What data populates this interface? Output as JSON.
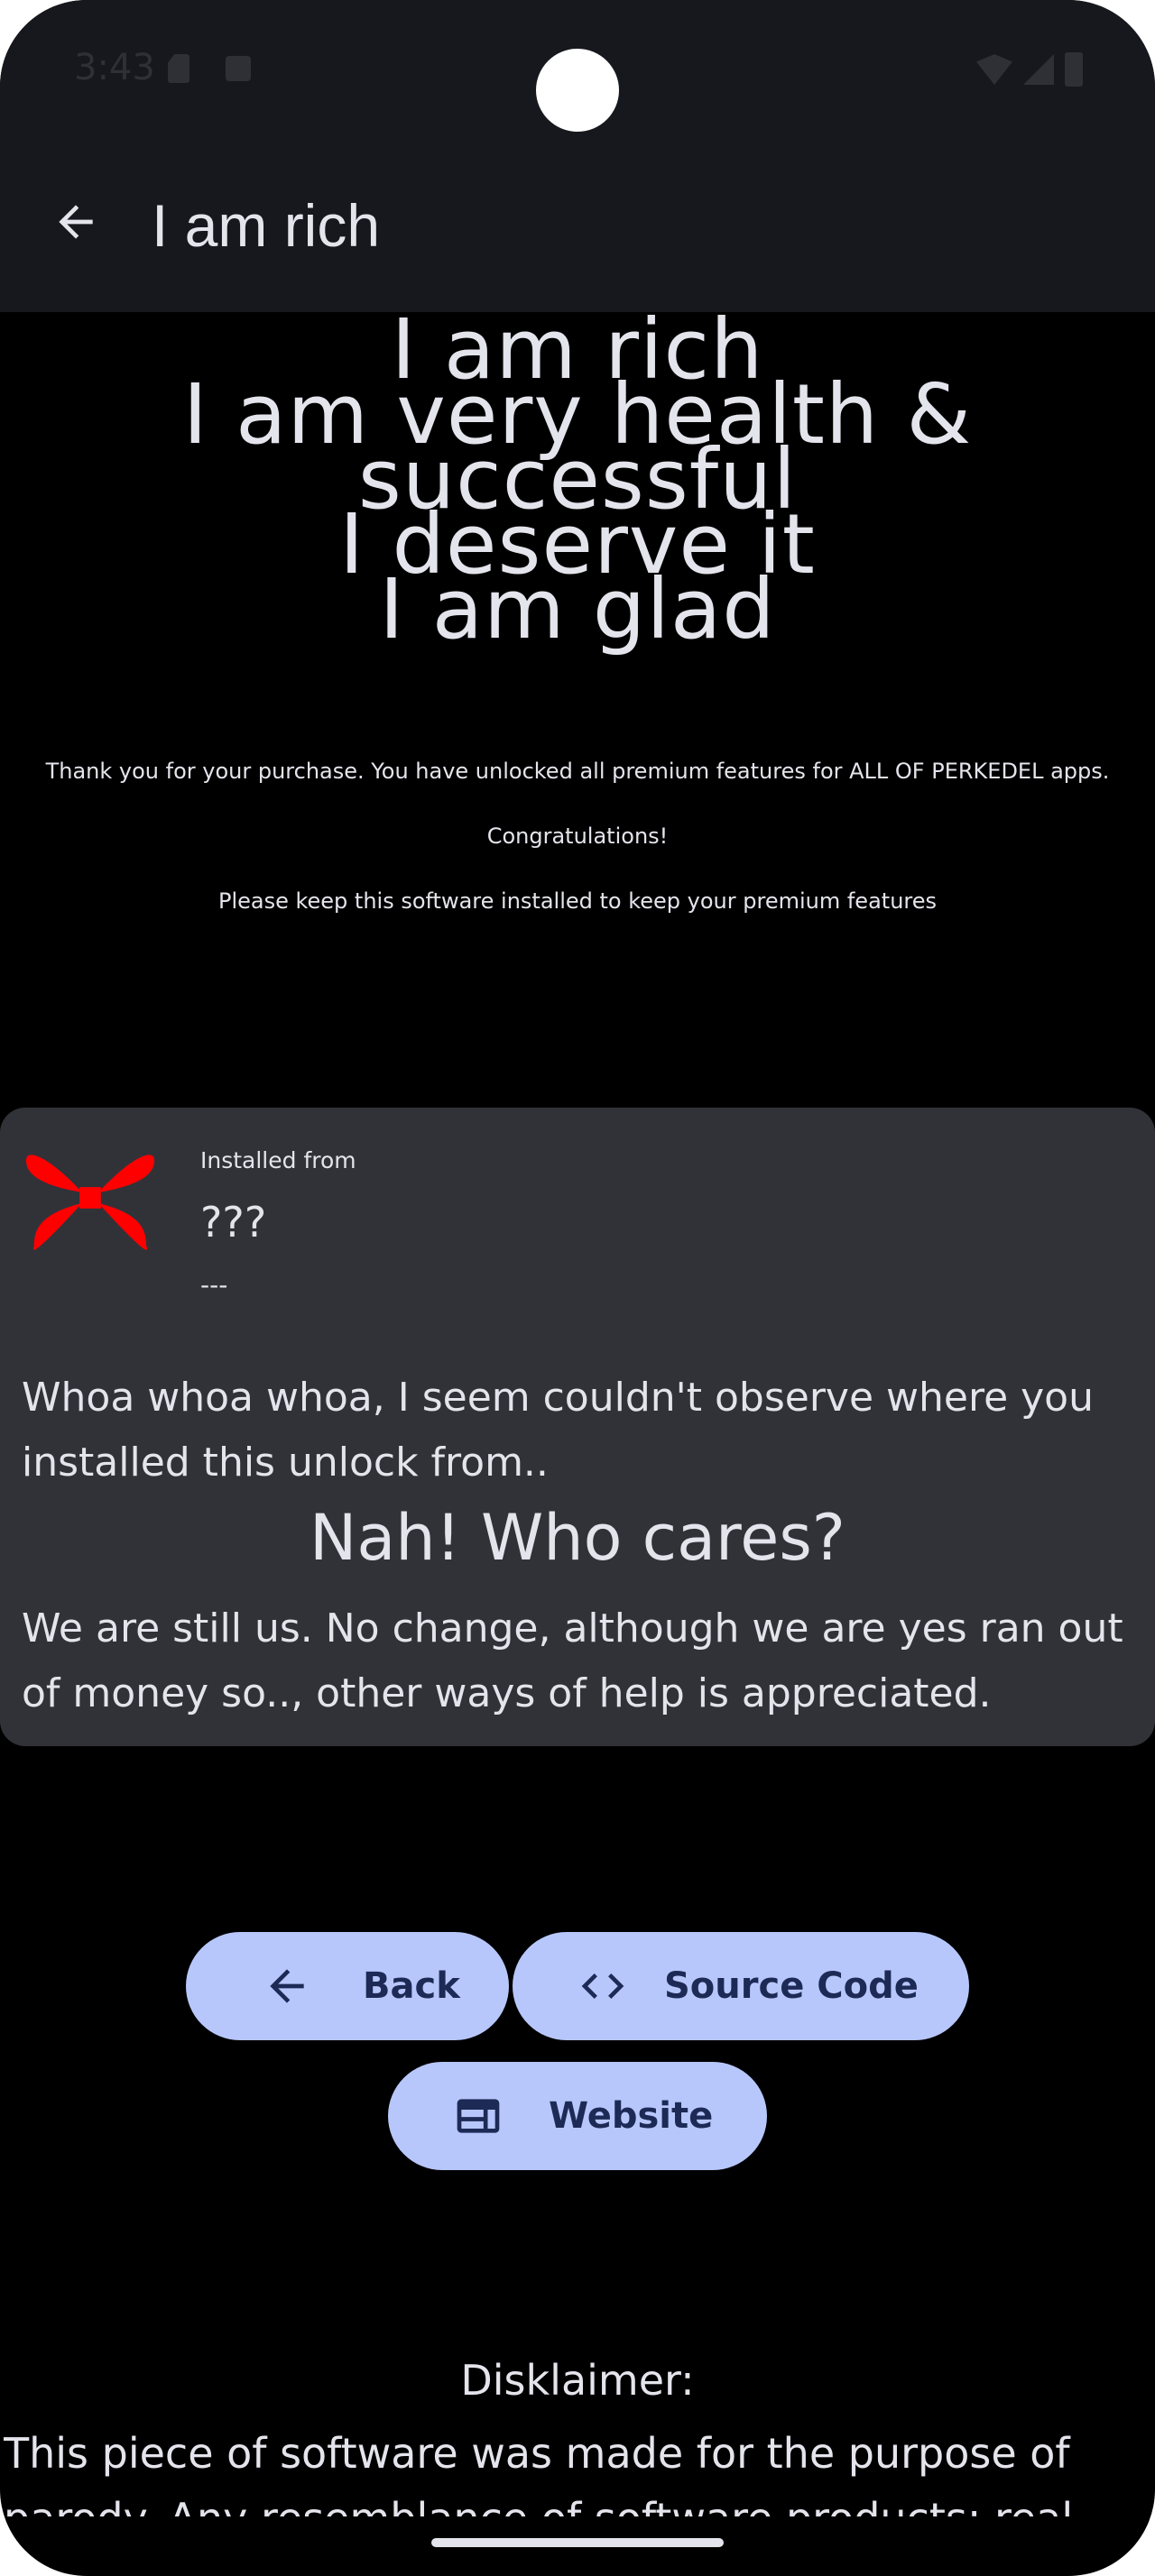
{
  "status_bar": {
    "time": "3:43",
    "icons": [
      "sd-card-icon",
      "a-icon",
      "wifi-icon",
      "signal-icon",
      "battery-icon"
    ]
  },
  "app_bar": {
    "back_icon": "arrow-left-icon",
    "title": "I am rich"
  },
  "headline": {
    "lines": [
      "I am rich",
      "I am very health &",
      "successful",
      "I deserve it",
      "I am glad"
    ]
  },
  "notes": {
    "thanks": "Thank you for your purchase. You have unlocked all premium features for ALL OF PERKEDEL apps.",
    "congrats": "Congratulations!",
    "keep_installed": "Please keep this software installed to keep your premium features"
  },
  "installer_card": {
    "logo_icon": "red-four-petal-logo",
    "logo_color": "#ff0000",
    "caption": "Installed from",
    "source": "???",
    "sub": "---",
    "paragraph1": "Whoa whoa whoa, I seem couldn't observe where you installed this unlock from..",
    "heading": "Nah! Who cares?",
    "paragraph2": "We are still us. No change, although we are yes ran out of money so.., other ways of help is appreciated."
  },
  "buttons": {
    "back": {
      "label": "Back",
      "icon": "arrow-left-icon"
    },
    "source_code": {
      "label": "Source Code",
      "icon": "code-icon"
    },
    "website": {
      "label": "Website",
      "icon": "web-icon"
    }
  },
  "disclaimer": {
    "title": "Disklaimer:",
    "text": "This piece of software was made for the purpose of parody. Any resemblance of software products; real"
  },
  "colors": {
    "background": "#000000",
    "app_bar": "#17181d",
    "card": "#313238",
    "button": "#b7c7fb",
    "button_text": "#1d2a56",
    "text": "#e4e4ec"
  }
}
